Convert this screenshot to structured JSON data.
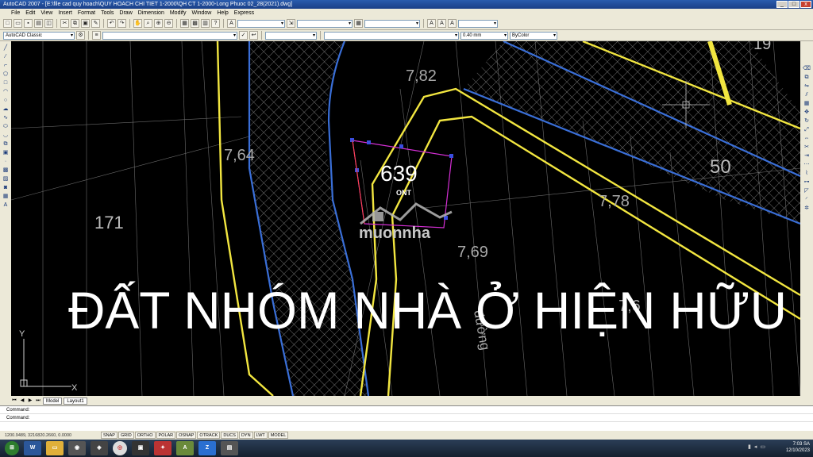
{
  "window": {
    "title": "AutoCAD 2007 - [E:\\file cad quy hoach\\QUY HOACH CHI TIET 1-2000\\QH CT 1-2000-Long Phuoc 02_28(2021).dwg]",
    "buttons": {
      "minimize": "_",
      "maximize": "□",
      "close": "x"
    }
  },
  "menu": [
    "File",
    "Edit",
    "View",
    "Insert",
    "Format",
    "Tools",
    "Draw",
    "Dimension",
    "Modify",
    "Window",
    "Help",
    "Express"
  ],
  "toolbar": {
    "workspace": "AutoCAD Classic",
    "lineweight": "0.40 mm",
    "color": "ByColor"
  },
  "drawing": {
    "parcel_number": "639",
    "parcel_type": "ONT",
    "label_171": "171",
    "label_50": "50",
    "elev_1": "7,82",
    "elev_2": "7,64",
    "elev_3": "7,78",
    "elev_4": "7,69",
    "elev_5": "7,6",
    "road_label": "đường",
    "overlay_text": "ĐẤT NHÓM NHÀ Ở HIỆN HỮU",
    "watermark": "muonnha",
    "label_top_right": "19",
    "ucs_y": "Y",
    "ucs_x": "X"
  },
  "tabs": [
    "Model",
    "Layout1"
  ],
  "command": {
    "line1": "Command:",
    "line2": "Command:"
  },
  "status": {
    "coords": "1200.9489, 3216820.2660, 0.0000",
    "buttons": [
      "SNAP",
      "GRID",
      "ORTHO",
      "POLAR",
      "OSNAP",
      "OTRACK",
      "DUCS",
      "DYN",
      "LWT",
      "MODEL"
    ]
  },
  "taskbar": {
    "time": "7:03 SA",
    "date": "12/10/2023"
  },
  "colors": {
    "yellow": "#f2e640",
    "blue": "#3a6fd8",
    "magenta": "#d42fd4",
    "canvas": "#000000"
  }
}
